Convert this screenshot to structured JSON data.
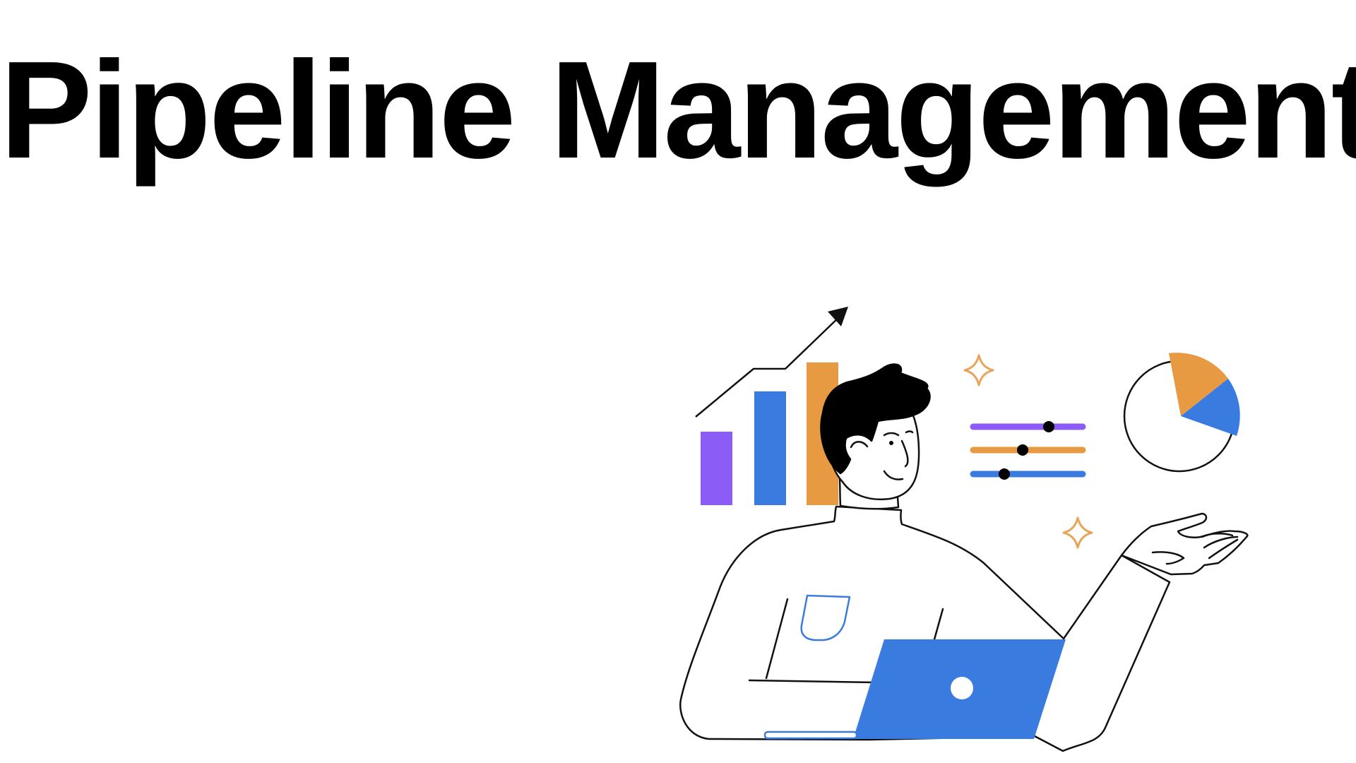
{
  "title": "Pipeline Management",
  "colors": {
    "background": "#ffffff",
    "text": "#000000",
    "purple": "#8b5cf6",
    "blue": "#3a7be0",
    "orange": "#e89a43",
    "star": "#e8a45a",
    "outline": "#111111"
  },
  "icons": {
    "growth_chart": "bar-chart-with-up-arrow",
    "sliders": "three-horizontal-sliders",
    "pie": "pie-chart",
    "sparkles": "sparkle-stars",
    "laptop": "laptop",
    "person": "man-presenting"
  },
  "sliders": [
    {
      "color": "#8b5cf6",
      "level": 0.68
    },
    {
      "color": "#e89a43",
      "level": 0.45
    },
    {
      "color": "#3a7be0",
      "level": 0.28
    }
  ],
  "pie_slices": [
    {
      "color": "#e89a43",
      "share": 0.19
    },
    {
      "color": "#3a7be0",
      "share": 0.13
    }
  ],
  "bars": [
    {
      "color": "#8b5cf6",
      "level": 0.52
    },
    {
      "color": "#3a7be0",
      "level": 0.81
    },
    {
      "color": "#e89a43",
      "level": 1.0
    }
  ]
}
